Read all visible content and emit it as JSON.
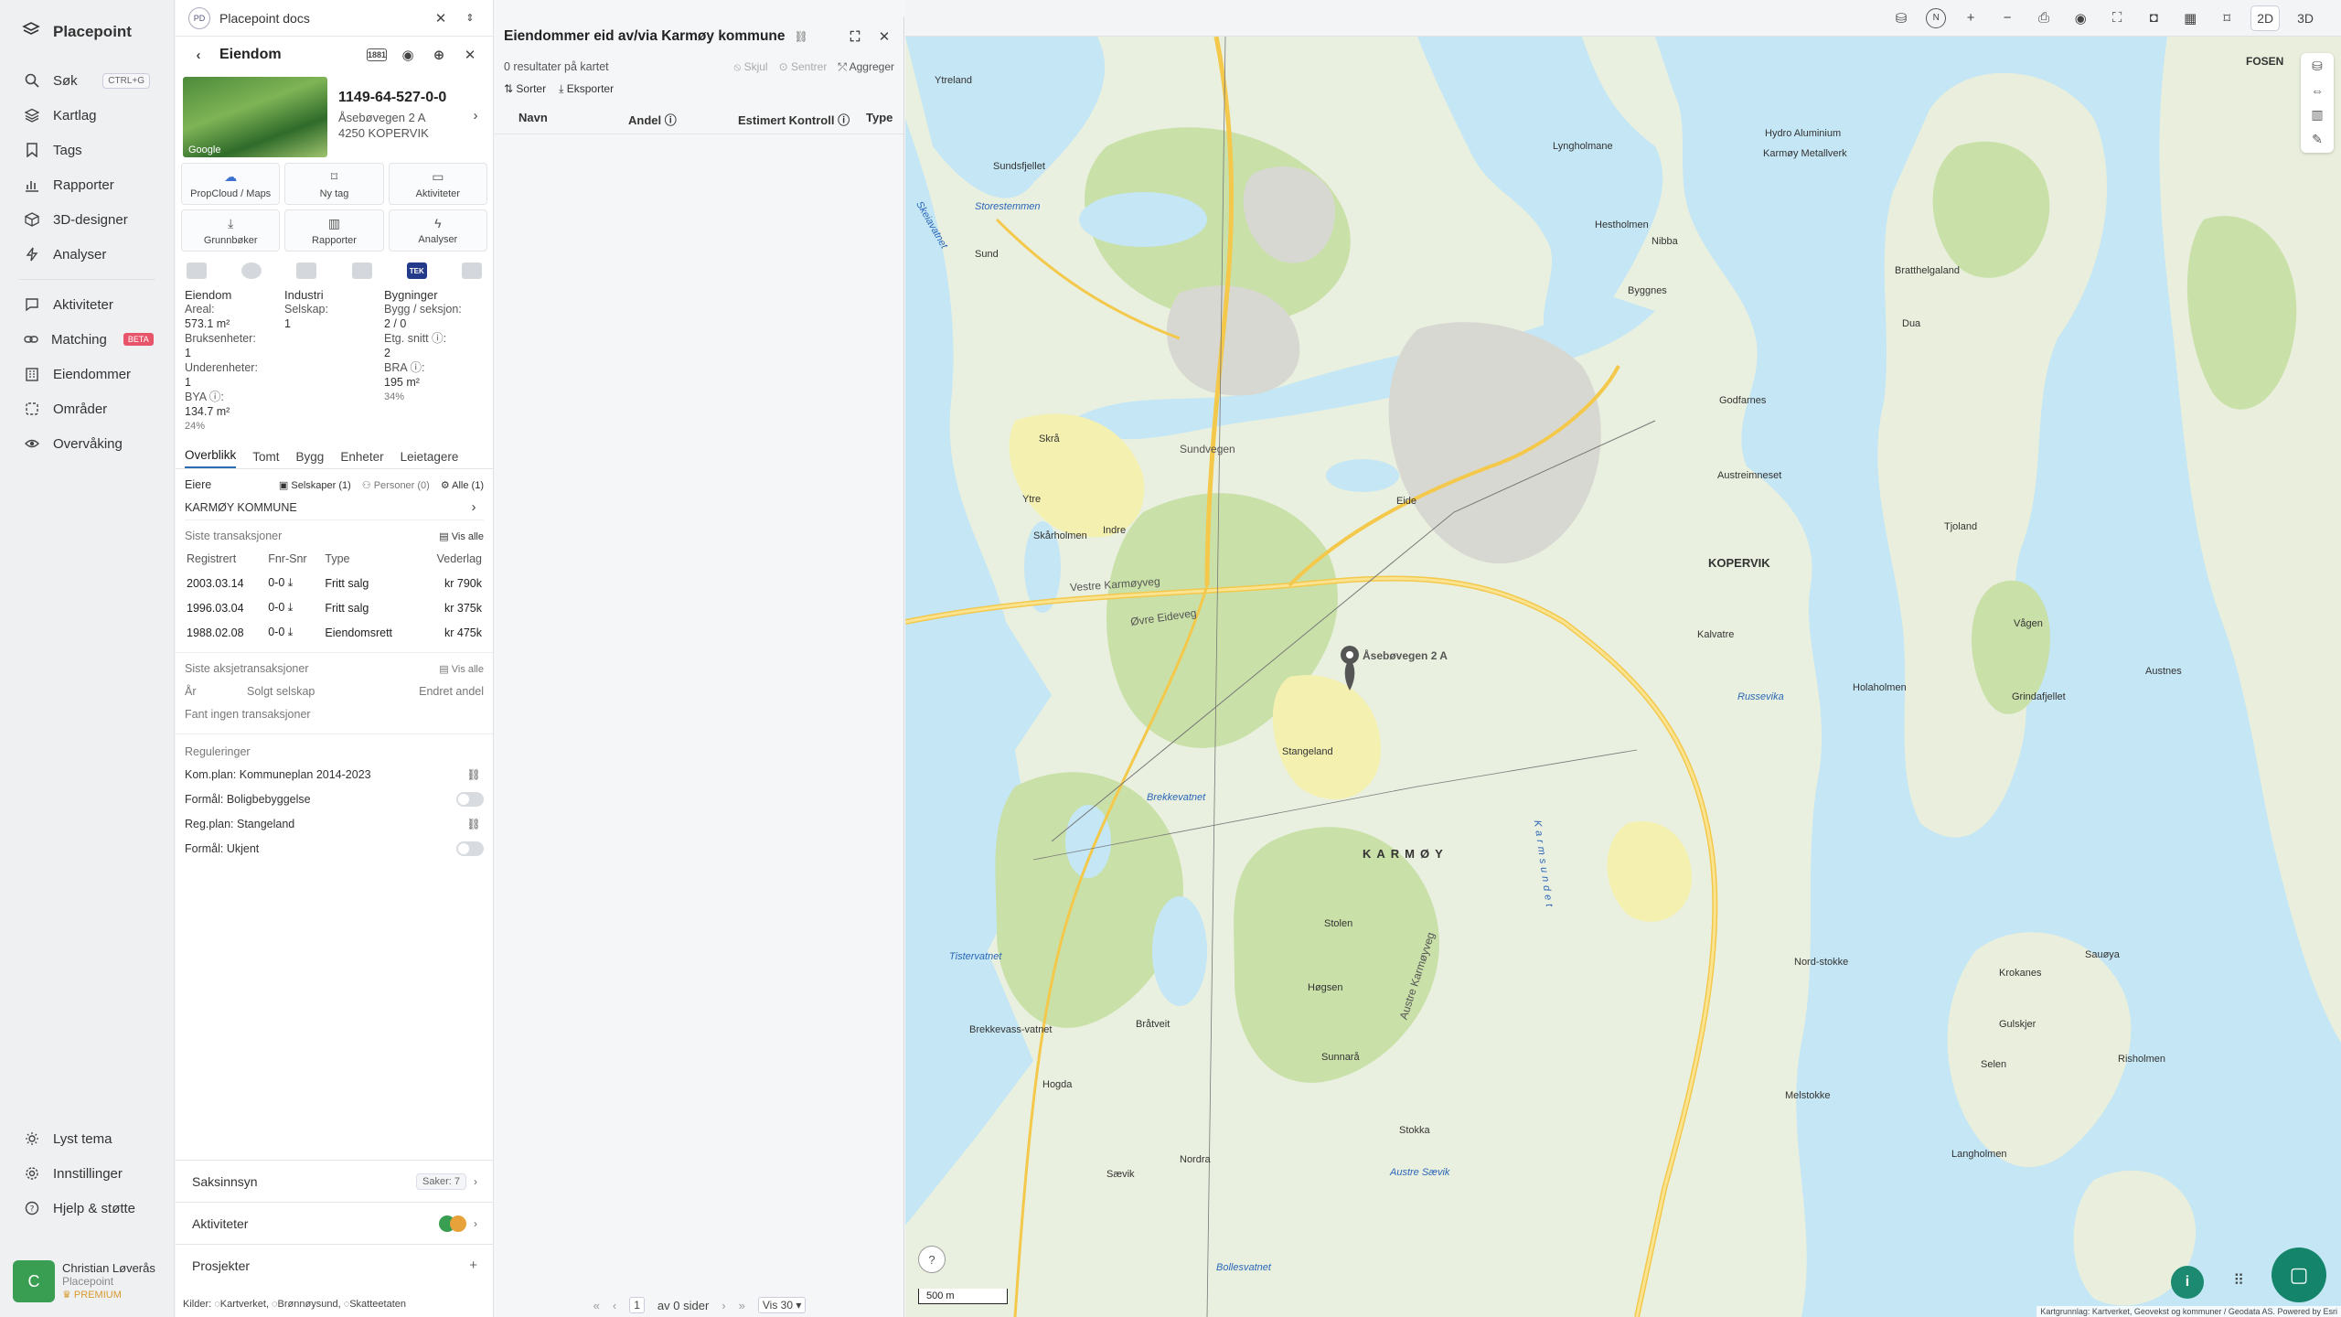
{
  "nav": {
    "brand": "Placepoint",
    "items": [
      {
        "label": "Søk",
        "kbd": "CTRL+G",
        "icon": "search-icon"
      },
      {
        "label": "Kartlag",
        "icon": "layers-icon"
      },
      {
        "label": "Tags",
        "icon": "bookmark-icon"
      },
      {
        "label": "Rapporter",
        "icon": "chart-icon"
      },
      {
        "label": "3D-designer",
        "icon": "cube-icon"
      },
      {
        "label": "Analyser",
        "icon": "bolt-icon"
      }
    ],
    "items2": [
      {
        "label": "Aktiviteter",
        "icon": "chat-icon"
      },
      {
        "label": "Matching",
        "badge": "BETA",
        "icon": "link-icon"
      },
      {
        "label": "Eiendommer",
        "icon": "building-icon"
      },
      {
        "label": "Områder",
        "icon": "area-icon"
      },
      {
        "label": "Overvåking",
        "icon": "eye-icon"
      }
    ],
    "bottom": [
      {
        "label": "Lyst tema",
        "icon": "sun-icon"
      },
      {
        "label": "Innstillinger",
        "icon": "gear-icon"
      },
      {
        "label": "Hjelp & støtte",
        "icon": "help-icon"
      }
    ],
    "user": {
      "initial": "C",
      "name": "Christian Løverås",
      "company": "Placepoint",
      "plan": "PREMIUM"
    }
  },
  "workspace": {
    "initials": "PD",
    "name": "Placepoint docs"
  },
  "property": {
    "title": "Eiendom",
    "gnr": "1149-64-527-0-0",
    "address1": "Åsebøvegen 2 A",
    "address2": "4250 KOPERVIK",
    "photo_label": "Google",
    "tiles": [
      {
        "label": "PropCloud / Maps",
        "icon": "cloud-icon"
      },
      {
        "label": "Ny tag",
        "icon": "bookmark-icon"
      },
      {
        "label": "Aktiviteter",
        "icon": "chat-icon"
      },
      {
        "label": "Grunnbøker",
        "icon": "download-icon"
      },
      {
        "label": "Rapporter",
        "icon": "chart-icon"
      },
      {
        "label": "Analyser",
        "icon": "bolt-icon"
      }
    ],
    "tek": "TEK",
    "stats": {
      "h1": "Eiendom",
      "h2": "Industri",
      "h3": "Bygninger",
      "areal_l": "Areal:",
      "areal_v": "573.1 m²",
      "selskap_l": "Selskap:",
      "selskap_v": "1",
      "bygg_l": "Bygg / seksjon:",
      "bygg_v": "2 / 0",
      "bruks_l": "Bruksenheter:",
      "bruks_v": "1",
      "etg_l": "Etg. snitt ⓘ:",
      "etg_v": "2",
      "under_l": "Underenheter:",
      "under_v": "1",
      "bra_l": "BRA ⓘ:",
      "bra_v": "195 m²",
      "bra_p": "34%",
      "bya_l": "BYA ⓘ:",
      "bya_v": "134.7 m²",
      "bya_p": "24%"
    },
    "tabs": [
      "Overblikk",
      "Tomt",
      "Bygg",
      "Enheter",
      "Leietagere"
    ],
    "owners": {
      "label": "Eiere",
      "companies": "Selskaper (1)",
      "persons": "Personer (0)",
      "all": "Alle (1)",
      "name": "KARMØY KOMMUNE"
    },
    "transactions": {
      "label": "Siste transaksjoner",
      "show_all": "Vis alle",
      "cols": [
        "Registrert",
        "Fnr-Snr",
        "Type",
        "Vederlag"
      ],
      "rows": [
        [
          "2003.03.14",
          "0-0 ⤓",
          "Fritt salg",
          "kr 790k"
        ],
        [
          "1996.03.04",
          "0-0 ⤓",
          "Fritt salg",
          "kr 375k"
        ],
        [
          "1988.02.08",
          "0-0 ⤓",
          "Eiendomsrett",
          "kr 475k"
        ]
      ]
    },
    "share_tx": {
      "label": "Siste aksjetransaksjoner",
      "show_all": "Vis alle",
      "cols": [
        "År",
        "Solgt selskap",
        "Endret andel"
      ],
      "empty": "Fant ingen transaksjoner"
    },
    "regs": {
      "label": "Reguleringer",
      "r1": "Kom.plan: Kommuneplan 2014-2023",
      "r2": "Formål: Boligbebyggelse",
      "r3": "Reg.plan: Stangeland",
      "r4": "Formål: Ukjent"
    },
    "saksinnsyn": {
      "label": "Saksinnsyn",
      "count": "Saker: 7"
    },
    "aktiviteter": {
      "label": "Aktiviteter"
    },
    "prosjekter": {
      "label": "Prosjekter"
    },
    "kilder": "Kilder: ◌Kartverket, ◌Brønnøysund, ◌Skatteetaten"
  },
  "results": {
    "title": "Eiendommer eid av/via Karmøy kommune",
    "count": "0 resultater på kartet",
    "hide": "Skjul",
    "center": "Sentrer",
    "aggregate": "Aggreger",
    "sort": "Sorter",
    "export": "Eksporter",
    "cols": [
      "Navn",
      "Andel ⓘ",
      "Estimert Kontroll ⓘ",
      "Type"
    ],
    "pager": {
      "page": "1",
      "of": "av 0 sider",
      "per": "Vis 30"
    }
  },
  "map": {
    "mode2d": "2D",
    "mode3d": "3D",
    "scale": "500 m",
    "attribution": "Kartgrunnlag: Kartverket, Geovekst og kommuner / Geodata AS. Powered by Esri",
    "labels": [
      "Kopervik",
      "KOPERVIK",
      "KARMØY",
      "Karmsundet",
      "Sundvegen",
      "Vestre Karmøyveg",
      "Øvre Eideveg",
      "Austre Karmøyveg",
      "Eide",
      "Stangeland",
      "Stolen",
      "Høgsen",
      "Sunnarå",
      "Bråtveit",
      "Sævik",
      "Skrå",
      "Ytre",
      "Indre",
      "Skårholmen",
      "Storestemmen",
      "Sund",
      "Sundsfjellet",
      "Nibba",
      "Hestholmen",
      "Byggnes",
      "Godfarnes",
      "Austreimneset",
      "Kalvatre",
      "Russevika",
      "Holaholmen",
      "Nord-stokke",
      "Melstokke",
      "Stokka",
      "Krokanes",
      "Sauøya",
      "Gulskjer",
      "Risholmen",
      "Selen",
      "Langholmen",
      "Austnes",
      "Grindafjellet",
      "Vågen",
      "Tjoland",
      "Bratthelgaland",
      "Dua",
      "FOSEN",
      "Ytreland",
      "Lyngholmane",
      "Hydro Aluminium",
      "Karmøy Metallverk",
      "Brekkevass-vatnet",
      "Hogda",
      "Nordra",
      "Austre Sævik",
      "Bollesvatnet",
      "Tistervatnet",
      "Brekkevatnet",
      "Skeiavatnet",
      "Åsebøvegen 2 A"
    ]
  }
}
